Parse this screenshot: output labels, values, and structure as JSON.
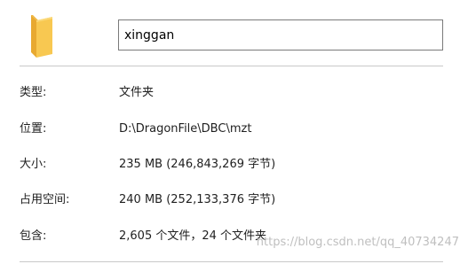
{
  "folder": {
    "icon": "folder-icon",
    "name_value": "xinggan",
    "color": "#f5c24b"
  },
  "properties": [
    {
      "label": "类型:",
      "value": "文件夹"
    },
    {
      "label": "位置:",
      "value": "D:\\DragonFile\\DBC\\mzt"
    },
    {
      "label": "大小:",
      "value": "235 MB (246,843,269 字节)"
    },
    {
      "label": "占用空间:",
      "value": "240 MB (252,133,376 字节)"
    },
    {
      "label": "包含:",
      "value": "2,605 个文件，24 个文件夹"
    }
  ],
  "watermark": "https://blog.csdn.net/qq_40734247"
}
